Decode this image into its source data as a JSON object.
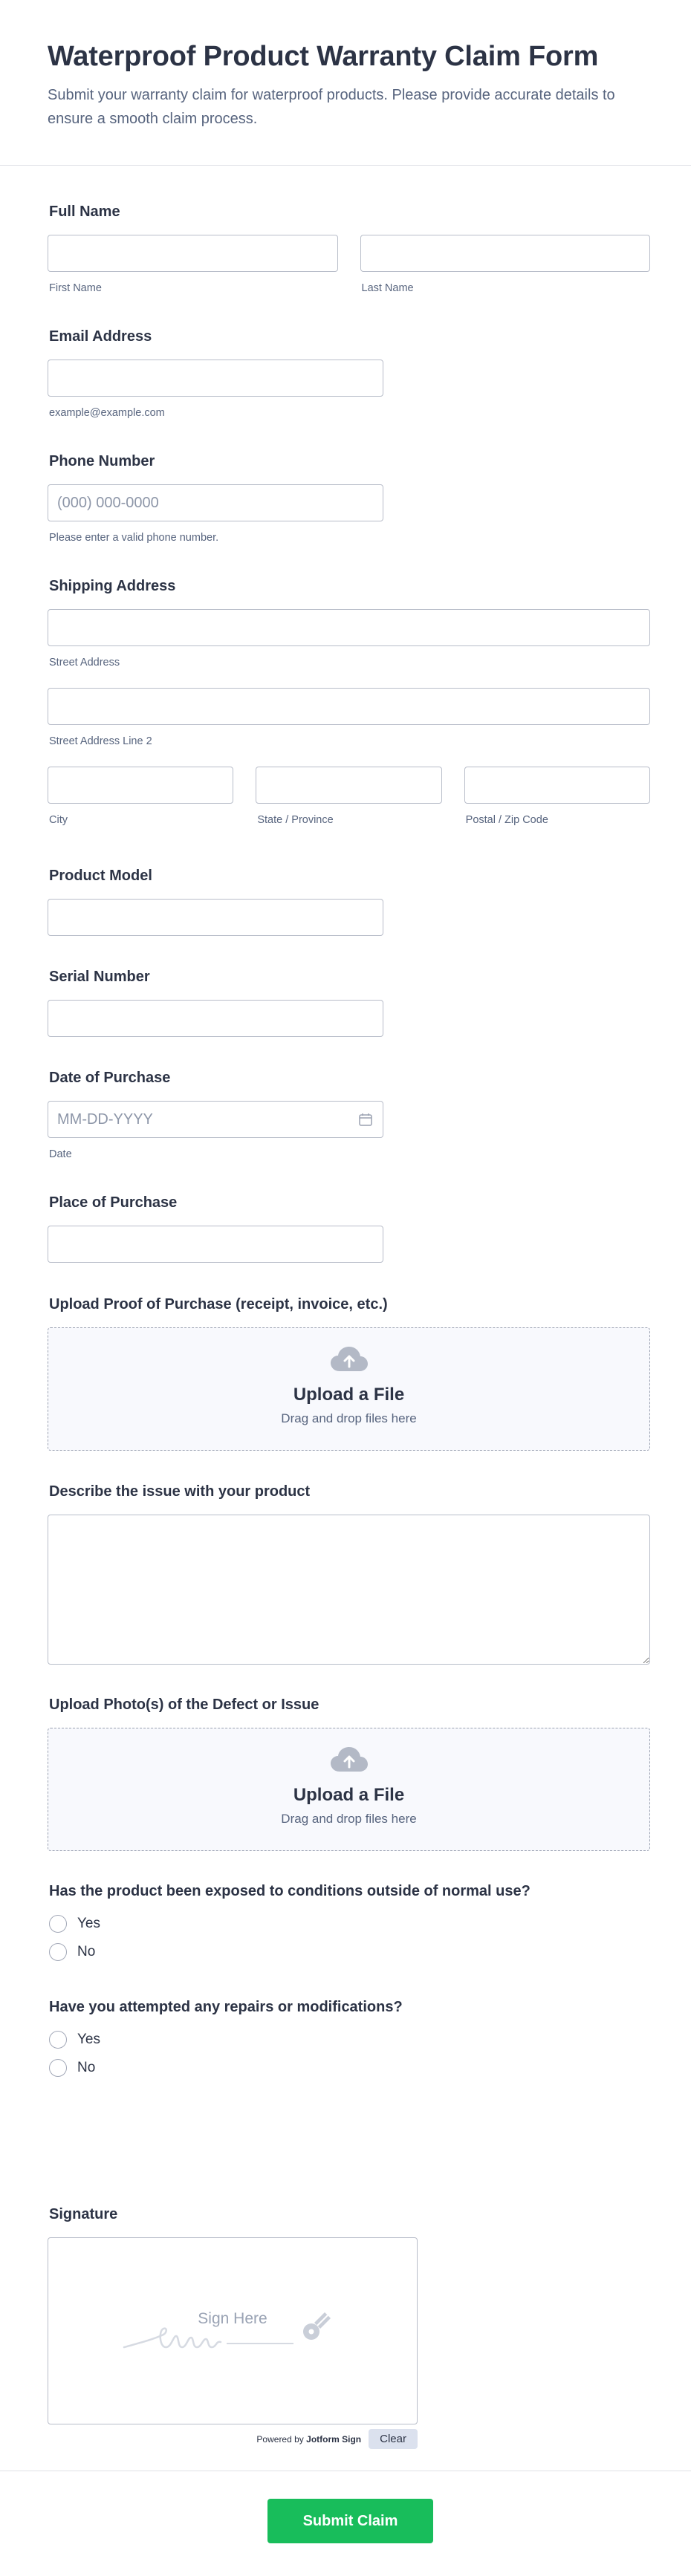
{
  "header": {
    "title": "Waterproof Product Warranty Claim Form",
    "description": "Submit your warranty claim for waterproof products. Please provide accurate details to ensure a smooth claim process."
  },
  "full_name": {
    "label": "Full Name",
    "first_sub": "First Name",
    "last_sub": "Last Name",
    "first_value": "",
    "last_value": ""
  },
  "email": {
    "label": "Email Address",
    "sub": "example@example.com",
    "value": ""
  },
  "phone": {
    "label": "Phone Number",
    "placeholder": "(000) 000-0000",
    "sub": "Please enter a valid phone number.",
    "value": ""
  },
  "address": {
    "label": "Shipping Address",
    "street_sub": "Street Address",
    "street2_sub": "Street Address Line 2",
    "city_sub": "City",
    "state_sub": "State / Province",
    "zip_sub": "Postal / Zip Code"
  },
  "product_model": {
    "label": "Product Model",
    "value": ""
  },
  "serial_number": {
    "label": "Serial Number",
    "value": ""
  },
  "purchase_date": {
    "label": "Date of Purchase",
    "placeholder": "MM-DD-YYYY",
    "sub": "Date"
  },
  "purchase_place": {
    "label": "Place of Purchase",
    "value": ""
  },
  "proof_upload": {
    "label": "Upload Proof of Purchase (receipt, invoice, etc.)",
    "title": "Upload a File",
    "hint": "Drag and drop files here"
  },
  "issue": {
    "label": "Describe the issue with your product",
    "value": ""
  },
  "defect_upload": {
    "label": "Upload Photo(s) of the Defect or Issue",
    "title": "Upload a File",
    "hint": "Drag and drop files here"
  },
  "exposed": {
    "label": "Has the product been exposed to conditions outside of normal use?",
    "options": [
      "Yes",
      "No"
    ]
  },
  "repairs": {
    "label": "Have you attempted any repairs or modifications?",
    "options": [
      "Yes",
      "No"
    ]
  },
  "signature": {
    "label": "Signature",
    "placeholder": "Sign Here",
    "powered_prefix": "Powered by",
    "powered_brand": "Jotform Sign",
    "clear_label": "Clear"
  },
  "submit_label": "Submit Claim",
  "colors": {
    "text": "#2c3345",
    "subtext": "#57647e",
    "border": "#b8bdc9",
    "submit": "#18bd5b"
  },
  "icons": [
    "cloud-upload-icon",
    "calendar-icon",
    "pen-icon"
  ]
}
